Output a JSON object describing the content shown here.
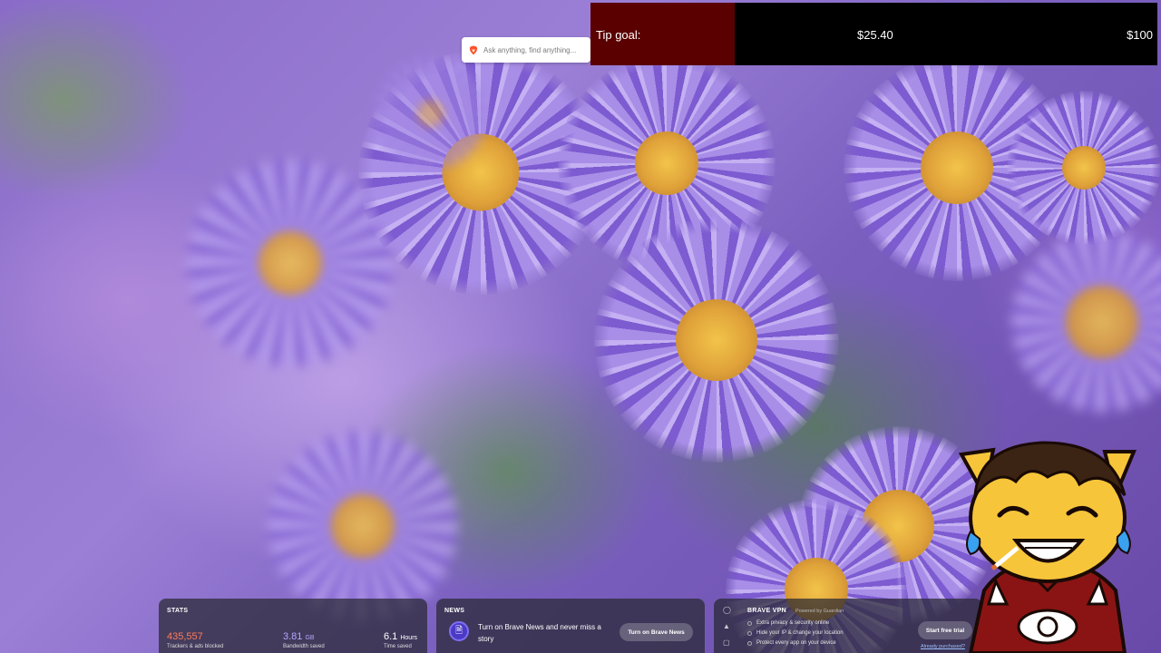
{
  "search": {
    "placeholder": "Ask anything, find anything..."
  },
  "tip_goal": {
    "label": "Tip goal:",
    "current": "$25.40",
    "goal": "$100",
    "progress_fraction": 0.254,
    "fill_color": "#5a0000"
  },
  "widgets": {
    "stats": {
      "title": "STATS",
      "trackers_value": "435,557",
      "trackers_label": "Trackers & ads blocked",
      "bandwidth_value": "3.81",
      "bandwidth_unit": "GB",
      "bandwidth_label": "Bandwidth saved",
      "time_value": "6.1",
      "time_unit": "Hours",
      "time_label": "Time saved",
      "colors": {
        "trackers": "#ff7a59",
        "bandwidth": "#b7a6ff",
        "time": "#ffffff"
      }
    },
    "news": {
      "title": "NEWS",
      "text": "Turn on Brave News and never miss a story",
      "button": "Turn on Brave News"
    },
    "vpn": {
      "title": "BRAVE VPN",
      "powered_by": "Powered by Guardian",
      "features": [
        "Extra privacy & security online",
        "Hide your IP & change your location",
        "Protect every app on your device"
      ],
      "button": "Start free trial",
      "link": "Already purchased?"
    }
  },
  "icons": {
    "brave": "brave-lion-icon",
    "news": "document-icon",
    "vpn_shield": "shield-icon",
    "warning": "warning-icon",
    "vpn_lock": "lock-icon"
  }
}
